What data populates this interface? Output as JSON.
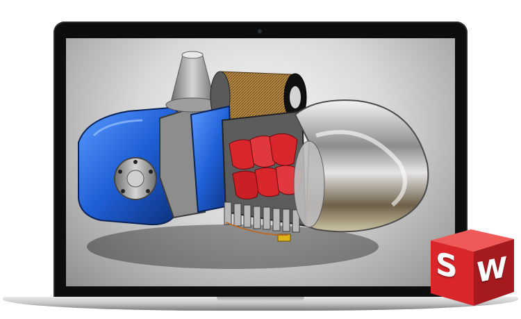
{
  "logo": {
    "letter_left": "S",
    "letter_right": "W",
    "colors": {
      "front": "#d9262b",
      "side": "#a51a1f",
      "top": "#ef5a58"
    }
  },
  "screen": {
    "content": "3d-cad-render",
    "colors": {
      "housing_blue": "#1f5fd6",
      "rotor_red": "#d8262c",
      "chrome": "#c8c8c8"
    }
  },
  "device": {
    "colors": {
      "bezel": "#0d0d0d",
      "base": "#c8c8c8"
    }
  }
}
